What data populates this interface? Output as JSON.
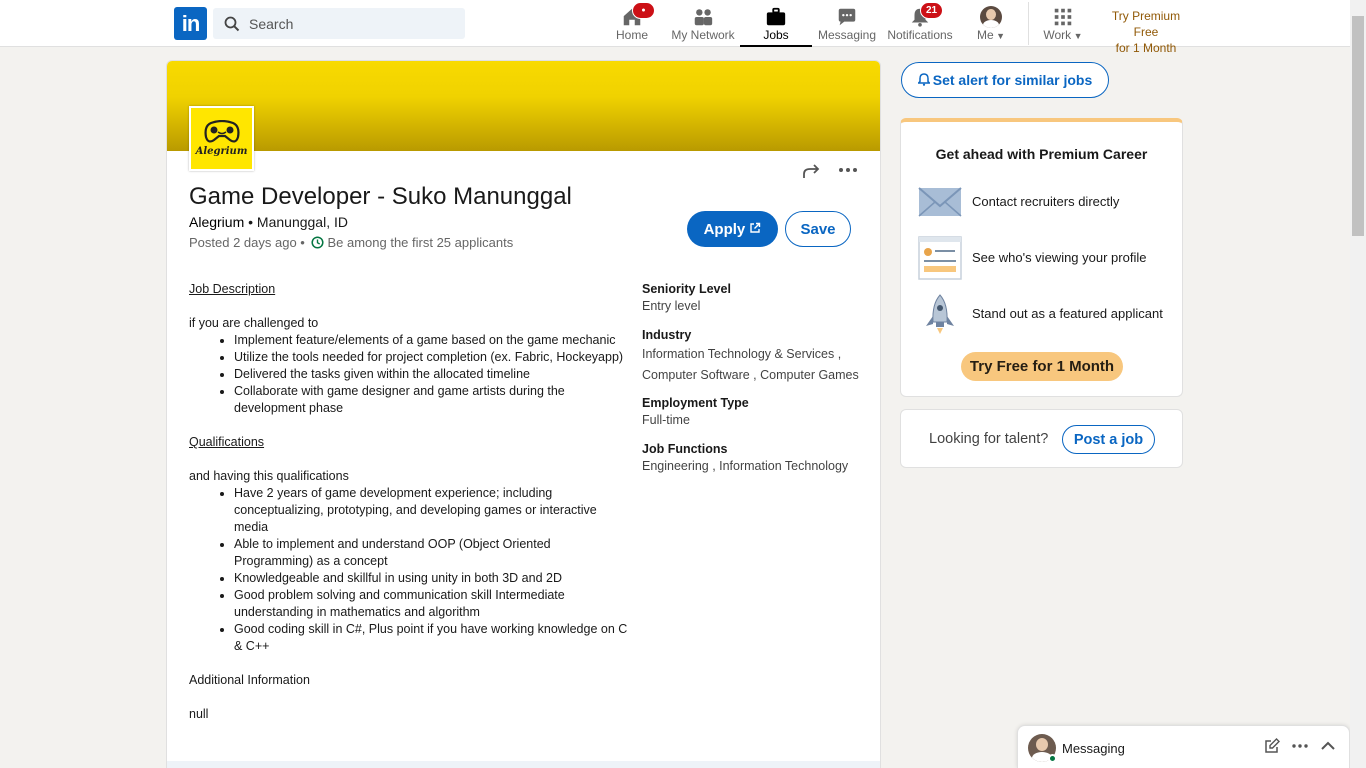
{
  "nav": {
    "search_placeholder": "Search",
    "items": [
      {
        "label": "Home",
        "badge": "●"
      },
      {
        "label": "My Network"
      },
      {
        "label": "Jobs"
      },
      {
        "label": "Messaging"
      },
      {
        "label": "Notifications",
        "badge": "21"
      },
      {
        "label": "Me"
      },
      {
        "label": "Work"
      }
    ],
    "premium_line1": "Try Premium Free",
    "premium_line2": "for 1 Month"
  },
  "job": {
    "company_logo_text": "Alegrium",
    "title": "Game Developer - Suko Manunggal",
    "company": "Alegrium",
    "location": " • Manunggal, ID",
    "posted": "Posted 2 days ago • ",
    "applicants": "Be among the first 25 applicants",
    "apply_label": "Apply",
    "save_label": "Save"
  },
  "description": {
    "heading1": "Job Description",
    "intro1": "if you are challenged to",
    "list1": [
      "Implement feature/elements of a game based on the game mechanic",
      "Utilize the tools needed for project completion (ex. Fabric, Hockeyapp)",
      "Delivered the tasks given within the allocated timeline",
      "Collaborate with game designer and game artists during the development phase"
    ],
    "heading2": "Qualifications",
    "intro2": "and having this qualifications",
    "list2": [
      "Have 2 years of game development experience; including conceptualizing, prototyping, and developing games or interactive media",
      "Able to implement and understand OOP (Object Oriented Programming) as a concept",
      "Knowledgeable and skillful in using unity in both 3D and 2D",
      "Good problem solving and communication skill Intermediate understanding in mathematics and algorithm",
      "Good coding skill in C#, Plus point if you have working knowledge on C & C++"
    ],
    "additional_heading": "Additional Information",
    "additional_value": "null"
  },
  "criteria": {
    "seniority_label": "Seniority Level",
    "seniority_value": "Entry level",
    "industry_label": "Industry",
    "industry_value": "Information Technology & Services , Computer Software , Computer Games",
    "employment_label": "Employment Type",
    "employment_value": "Full-time",
    "functions_label": "Job Functions",
    "functions_value": "Engineering , Information Technology"
  },
  "rail": {
    "alert_label": "Set alert for similar jobs",
    "premium_title": "Get ahead with Premium Career",
    "perks": [
      "Contact recruiters directly",
      "See who's viewing your profile",
      "Stand out as a featured applicant"
    ],
    "try_free_label": "Try Free for 1 Month",
    "talent_text": "Looking for talent?",
    "post_job_label": "Post a job"
  },
  "messaging_dock": {
    "label": "Messaging"
  },
  "colors": {
    "brand_blue": "#0a66c2",
    "premium_gold": "#f8c77e",
    "banner_yellow": "#f8da00",
    "badge_red": "#cc1016"
  }
}
